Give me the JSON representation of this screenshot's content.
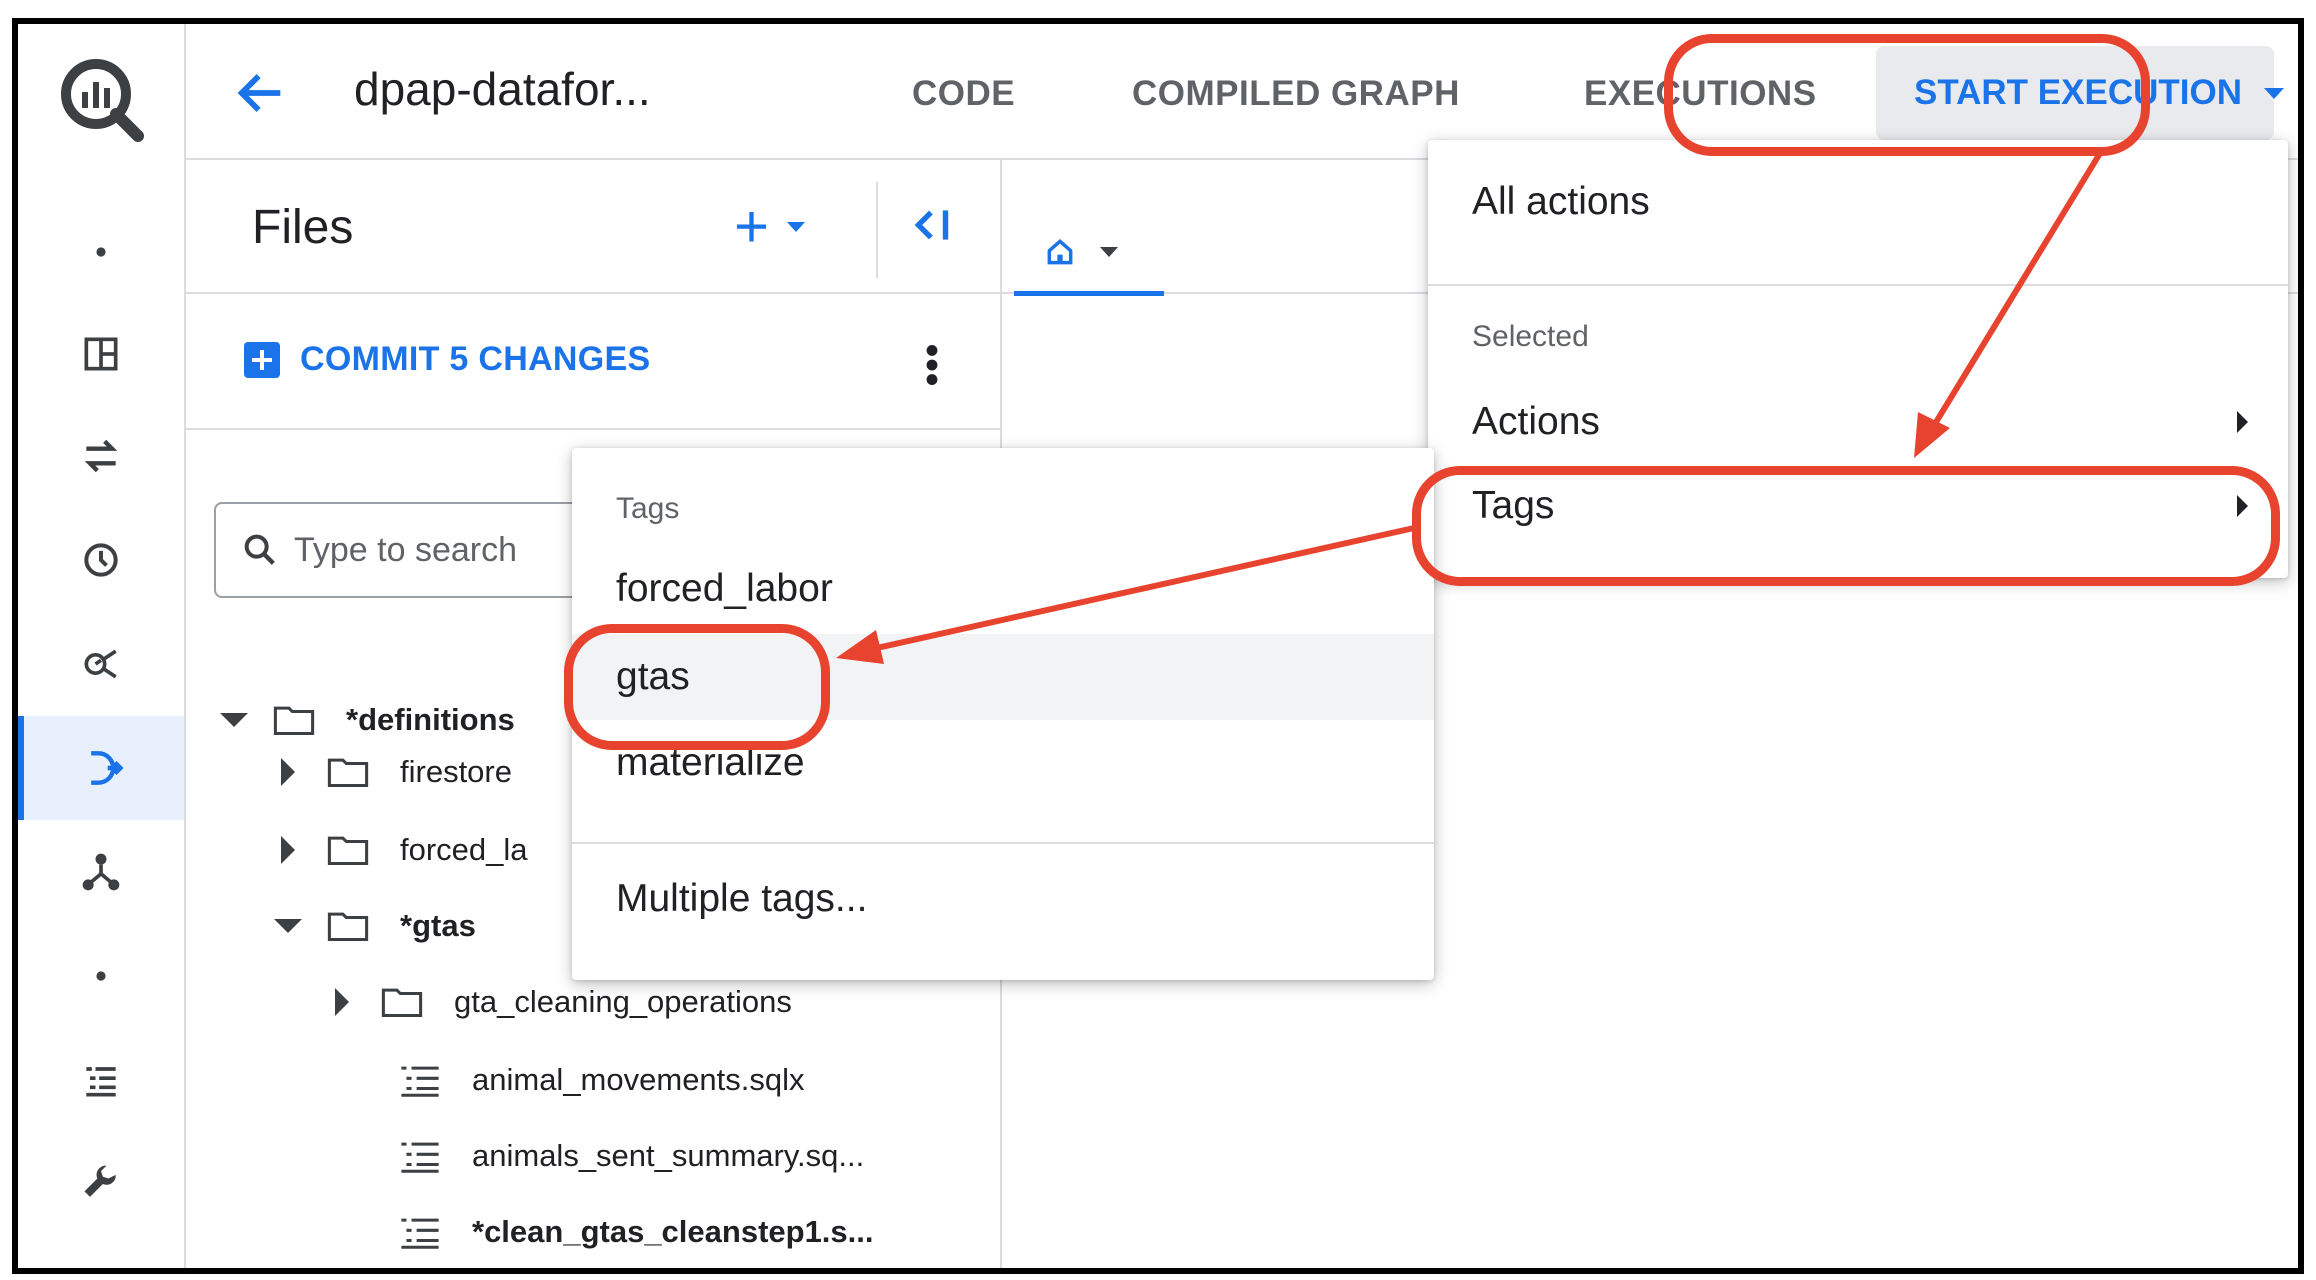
{
  "header": {
    "title": "dpap-datafor...",
    "tabs": [
      "CODE",
      "COMPILED GRAPH",
      "EXECUTIONS"
    ],
    "start_execution_label": "START EXECUTION"
  },
  "files": {
    "title": "Files",
    "commit_label": "COMMIT 5 CHANGES",
    "search_placeholder": "Type to search",
    "tree": [
      {
        "name": "*definitions",
        "type": "folder",
        "expanded": true,
        "bold": true
      },
      {
        "name": "firestore",
        "type": "folder",
        "expanded": false,
        "bold": false
      },
      {
        "name": "forced_la",
        "type": "folder",
        "expanded": false,
        "bold": false
      },
      {
        "name": "*gtas",
        "type": "folder",
        "expanded": true,
        "bold": true
      },
      {
        "name": "gta_cleaning_operations",
        "type": "folder",
        "expanded": false,
        "bold": false
      },
      {
        "name": "animal_movements.sqlx",
        "type": "file",
        "bold": false
      },
      {
        "name": "animals_sent_summary.sq...",
        "type": "file",
        "bold": false
      },
      {
        "name": "*clean_gtas_cleanstep1.s...",
        "type": "file",
        "bold": true
      }
    ]
  },
  "start_menu": {
    "all_actions": "All actions",
    "section": "Selected",
    "items": [
      "Actions",
      "Tags"
    ]
  },
  "tags_menu": {
    "section": "Tags",
    "items": [
      "forced_labor",
      "gtas",
      "materialize"
    ],
    "multiple": "Multiple tags...",
    "hovered": "gtas"
  },
  "colors": {
    "accent": "#1a73e8",
    "annotation": "#e8432f"
  },
  "icons": {
    "rail": [
      "bigquery-logo",
      "dot-icon",
      "panel-icon",
      "transfer-icon",
      "history-icon",
      "analytics-icon",
      "dataform-icon",
      "graph-icon",
      "dot-icon",
      "list-icon",
      "wrench-icon"
    ]
  }
}
